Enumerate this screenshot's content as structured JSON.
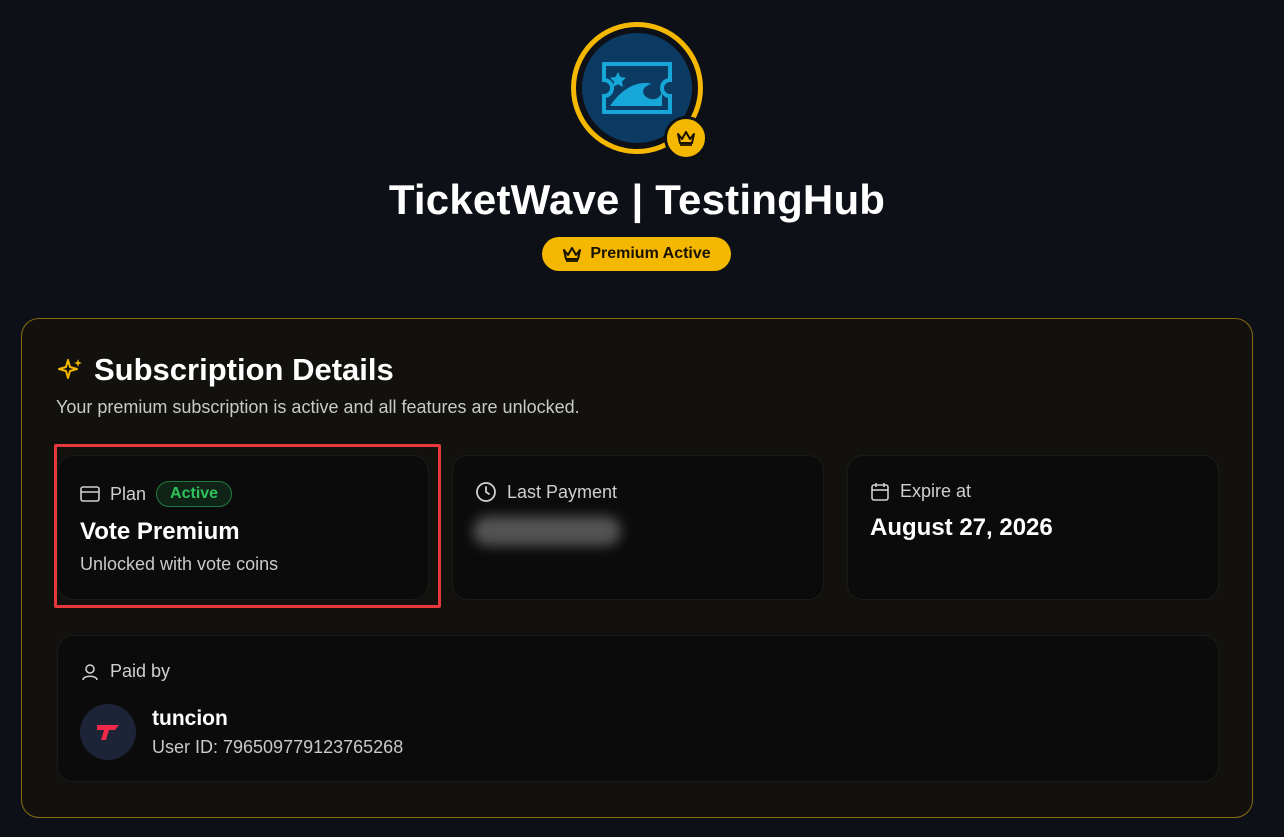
{
  "server": {
    "name": "TicketWave | TestingHub",
    "badge_label": "Premium Active"
  },
  "subscription": {
    "title": "Subscription Details",
    "subtitle": "Your premium subscription is active and all features are unlocked.",
    "plan": {
      "label": "Plan",
      "status": "Active",
      "name": "Vote Premium",
      "note": "Unlocked with vote coins"
    },
    "last_payment": {
      "label": "Last Payment"
    },
    "expire": {
      "label": "Expire at",
      "value": "August 27, 2026"
    },
    "paid_by": {
      "label": "Paid by",
      "username": "tuncion",
      "user_id": "User ID: 796509779123765268"
    }
  },
  "colors": {
    "accent": "#f5b800",
    "active_green": "#2fc25b",
    "highlight_red": "#e5393b",
    "background": "#0d1117"
  },
  "icons": {
    "avatar": "ticket-wave-icon",
    "crown": "crown-icon",
    "sparkle": "sparkles-icon",
    "card": "credit-card-icon",
    "clock": "clock-icon",
    "calendar": "calendar-icon",
    "user": "user-icon"
  }
}
